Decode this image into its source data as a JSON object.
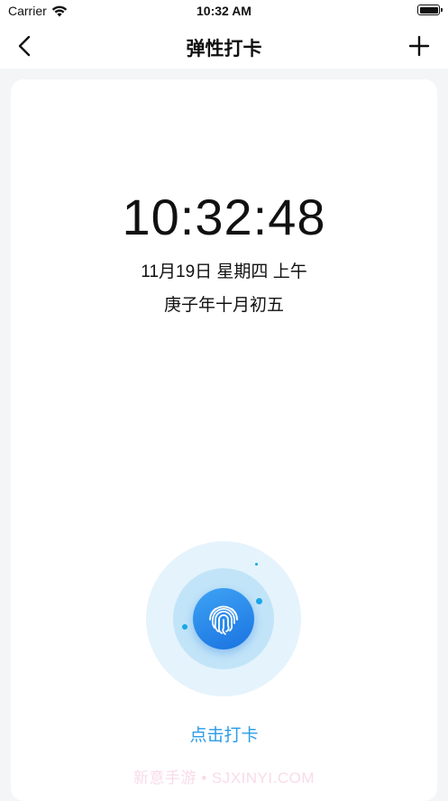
{
  "status_bar": {
    "carrier": "Carrier",
    "time": "10:32 AM",
    "wifi_icon": "wifi-icon",
    "battery_icon": "battery-icon"
  },
  "nav": {
    "title": "弹性打卡",
    "back_icon": "chevron-left-icon",
    "add_icon": "plus-icon"
  },
  "clock": {
    "time": "10:32:48",
    "date": "11月19日 星期四 上午",
    "lunar": "庚子年十月初五"
  },
  "punch": {
    "label": "点击打卡",
    "icon": "fingerprint-icon"
  },
  "watermark": "新意手游 • SJXINYI.COM",
  "colors": {
    "accent": "#2b9be8",
    "button_gradient_start": "#3ea3f5",
    "button_gradient_end": "#1a73e0",
    "ring_outer": "#e4f3fc",
    "ring_mid": "#c2e4f8",
    "background": "#f4f5f7"
  }
}
